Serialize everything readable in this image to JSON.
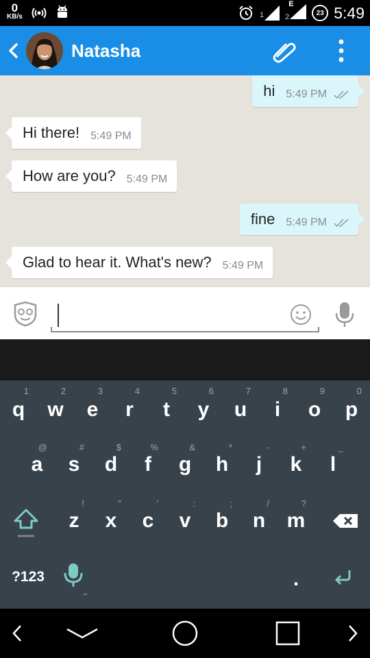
{
  "status_bar": {
    "net_speed": "0",
    "net_speed_unit": "KB/s",
    "sim1_label": "1",
    "sim2_label": "2",
    "sim2_network": "E",
    "battery": "23",
    "time": "5:49",
    "icons": [
      "wifi-hotspot-icon",
      "android-icon",
      "alarm-icon",
      "signal-icon",
      "battery-icon"
    ]
  },
  "header": {
    "contact_name": "Natasha",
    "accent": "#1a8ee6",
    "icons": [
      "back-icon",
      "avatar",
      "attach-icon",
      "more-icon"
    ]
  },
  "messages": [
    {
      "direction": "out",
      "text": "hi",
      "time": "5:49 PM",
      "status": "read"
    },
    {
      "direction": "in",
      "text": "Hi there!",
      "time": "5:49 PM"
    },
    {
      "direction": "in",
      "text": "How are you?",
      "time": "5:49 PM"
    },
    {
      "direction": "out",
      "text": "fine",
      "time": "5:49 PM",
      "status": "read"
    },
    {
      "direction": "in",
      "text": "Glad to hear it. What's new?",
      "time": "5:49 PM"
    }
  ],
  "composer": {
    "value": "",
    "placeholder": "",
    "icons": [
      "mask-icon",
      "smiley-icon",
      "mic-icon"
    ]
  },
  "keyboard": {
    "row1": [
      {
        "key": "q",
        "hint": "1"
      },
      {
        "key": "w",
        "hint": "2"
      },
      {
        "key": "e",
        "hint": "3"
      },
      {
        "key": "r",
        "hint": "4"
      },
      {
        "key": "t",
        "hint": "5"
      },
      {
        "key": "y",
        "hint": "6"
      },
      {
        "key": "u",
        "hint": "7"
      },
      {
        "key": "i",
        "hint": "8"
      },
      {
        "key": "o",
        "hint": "9"
      },
      {
        "key": "p",
        "hint": "0"
      }
    ],
    "row2": [
      {
        "key": "a",
        "hint": "@"
      },
      {
        "key": "s",
        "hint": "#"
      },
      {
        "key": "d",
        "hint": "$"
      },
      {
        "key": "f",
        "hint": "%"
      },
      {
        "key": "g",
        "hint": "&"
      },
      {
        "key": "h",
        "hint": "*"
      },
      {
        "key": "j",
        "hint": "-"
      },
      {
        "key": "k",
        "hint": "+"
      },
      {
        "key": "l",
        "hint": "_"
      }
    ],
    "row3": [
      {
        "key": "z",
        "hint": "!"
      },
      {
        "key": "x",
        "hint": "\""
      },
      {
        "key": "c",
        "hint": "'"
      },
      {
        "key": "v",
        "hint": ":"
      },
      {
        "key": "b",
        "hint": ";"
      },
      {
        "key": "n",
        "hint": "/"
      },
      {
        "key": "m",
        "hint": "?"
      }
    ],
    "symbols_label": "?123",
    "period_label": ".",
    "accent": "#7ecbc3",
    "icons": [
      "shift-icon",
      "backspace-icon",
      "keyboard-mic-icon",
      "enter-icon"
    ]
  },
  "nav": {
    "icons": [
      "nav-back-icon",
      "nav-hide-keyboard-icon",
      "nav-home-icon",
      "nav-recents-icon",
      "nav-forward-icon"
    ]
  }
}
